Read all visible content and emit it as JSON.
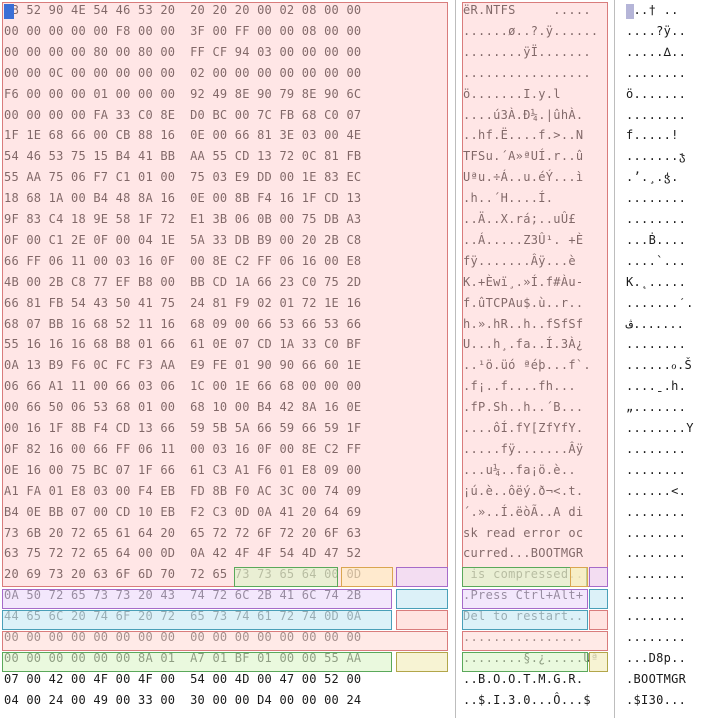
{
  "hex_rows": [
    "EB 52 90 4E 54 46 53 20  20 20 20 00 02 08 00 00",
    "00 00 00 00 00 F8 00 00  3F 00 FF 00 00 08 00 00",
    "00 00 00 00 80 00 80 00  FF CF 94 03 00 00 00 00",
    "00 00 0C 00 00 00 00 00  02 00 00 00 00 00 00 00",
    "F6 00 00 00 01 00 00 00  92 49 8E 90 79 8E 90 6C",
    "00 00 00 00 FA 33 C0 8E  D0 BC 00 7C FB 68 C0 07",
    "1F 1E 68 66 00 CB 88 16  0E 00 66 81 3E 03 00 4E",
    "54 46 53 75 15 B4 41 BB  AA 55 CD 13 72 0C 81 FB",
    "55 AA 75 06 F7 C1 01 00  75 03 E9 DD 00 1E 83 EC",
    "18 68 1A 00 B4 48 8A 16  0E 00 8B F4 16 1F CD 13",
    "9F 83 C4 18 9E 58 1F 72  E1 3B 06 0B 00 75 DB A3",
    "0F 00 C1 2E 0F 00 04 1E  5A 33 DB B9 00 20 2B C8",
    "66 FF 06 11 00 03 16 0F  00 8E C2 FF 06 16 00 E8",
    "4B 00 2B C8 77 EF B8 00  BB CD 1A 66 23 C0 75 2D",
    "66 81 FB 54 43 50 41 75  24 81 F9 02 01 72 1E 16",
    "68 07 BB 16 68 52 11 16  68 09 00 66 53 66 53 66",
    "55 16 16 16 68 B8 01 66  61 0E 07 CD 1A 33 C0 BF",
    "0A 13 B9 F6 0C FC F3 AA  E9 FE 01 90 90 66 60 1E",
    "06 66 A1 11 00 66 03 06  1C 00 1E 66 68 00 00 00",
    "00 66 50 06 53 68 01 00  68 10 00 B4 42 8A 16 0E",
    "00 16 1F 8B F4 CD 13 66  59 5B 5A 66 59 66 59 1F",
    "0F 82 16 00 66 FF 06 11  00 03 16 0F 00 8E C2 FF",
    "0E 16 00 75 BC 07 1F 66  61 C3 A1 F6 01 E8 09 00",
    "A1 FA 01 E8 03 00 F4 EB  FD 8B F0 AC 3C 00 74 09",
    "B4 0E BB 07 00 CD 10 EB  F2 C3 0D 0A 41 20 64 69",
    "73 6B 20 72 65 61 64 20  65 72 72 6F 72 20 6F 63",
    "63 75 72 72 65 64 00 0D  0A 42 4F 4F 54 4D 47 52",
    "20 69 73 20 63 6F 6D 70  72 65 73 73 65 64 00 0D",
    "0A 50 72 65 73 73 20 43  74 72 6C 2B 41 6C 74 2B",
    "44 65 6C 20 74 6F 20 72  65 73 74 61 72 74 0D 0A",
    "00 00 00 00 00 00 00 00  00 00 00 00 00 00 00 00",
    "00 00 00 00 00 00 8A 01  A7 01 BF 01 00 00 55 AA",
    "07 00 42 00 4F 00 4F 00  54 00 4D 00 47 00 52 00",
    "04 00 24 00 49 00 33 00  30 00 00 D4 00 00 00 24"
  ],
  "text_rows": [
    "ëR.NTFS     .....",
    "......ø..?.ÿ......",
    "........ÿÏ.......",
    ".................",
    "ö.......I.y.l",
    "....ú3À.Ð¼.|ûhÀ.",
    "..hf.Ë....f.>..N",
    "TFSu.´A»ªUÍ.r..û",
    "Uªu.÷Á..u.éÝ...ì",
    ".h..´H....Í.",
    "..Ä..X.rá;..uÛ£",
    "..Á.....Z3Û¹. +È",
    "fÿ.......Âÿ...è",
    "K.+Èwï¸.»Í.f#Àu-",
    "f.ûTCPAu$.ù..r..",
    "h.».hR..h..fSfSf",
    "U...h¸.fa..Í.3À¿",
    "..¹ö.üó ªéþ...f`.",
    ".f¡..f....fh...",
    ".fP.Sh..h..´B...",
    "....ôÍ.fY[ZfYfY.",
    ".....fÿ.......Âÿ",
    "...u¼..fa¡ö.è..",
    "¡ú.è..ôëý.ð¬<.t.",
    "´.»..Í.ëòÃ..A di",
    "sk read error oc",
    "curred...BOOTMGR",
    " is compressed..",
    ".Press Ctrl+Alt+",
    "Del to restart..",
    "................",
    "........§.¿.....Uª",
    "..B.O.O.T.M.G.R.",
    "..$.I.3.0...Ô...$"
  ],
  "alt_rows": [
    "...† ..",
    "....?ÿ..",
    ".....∆..",
    "........",
    "ö.......",
    "........",
    "f.....!",
    ".......ჯ",
    ".ʼ.¸.ჭ.",
    "........",
    "........",
    "...Ḃ....",
    "....`...",
    "K.˛.....",
    ".......ˊ.",
    "ڤ.......",
    "........",
    "......ℴ.Š",
    "....ˍ.h.",
    "„.......",
    "........Y",
    "........",
    "........",
    "......<.",
    "........",
    "........",
    "........",
    "........",
    "........",
    "........",
    "........",
    "...D8p..",
    ".BOOTMGR",
    ".$I30..."
  ]
}
